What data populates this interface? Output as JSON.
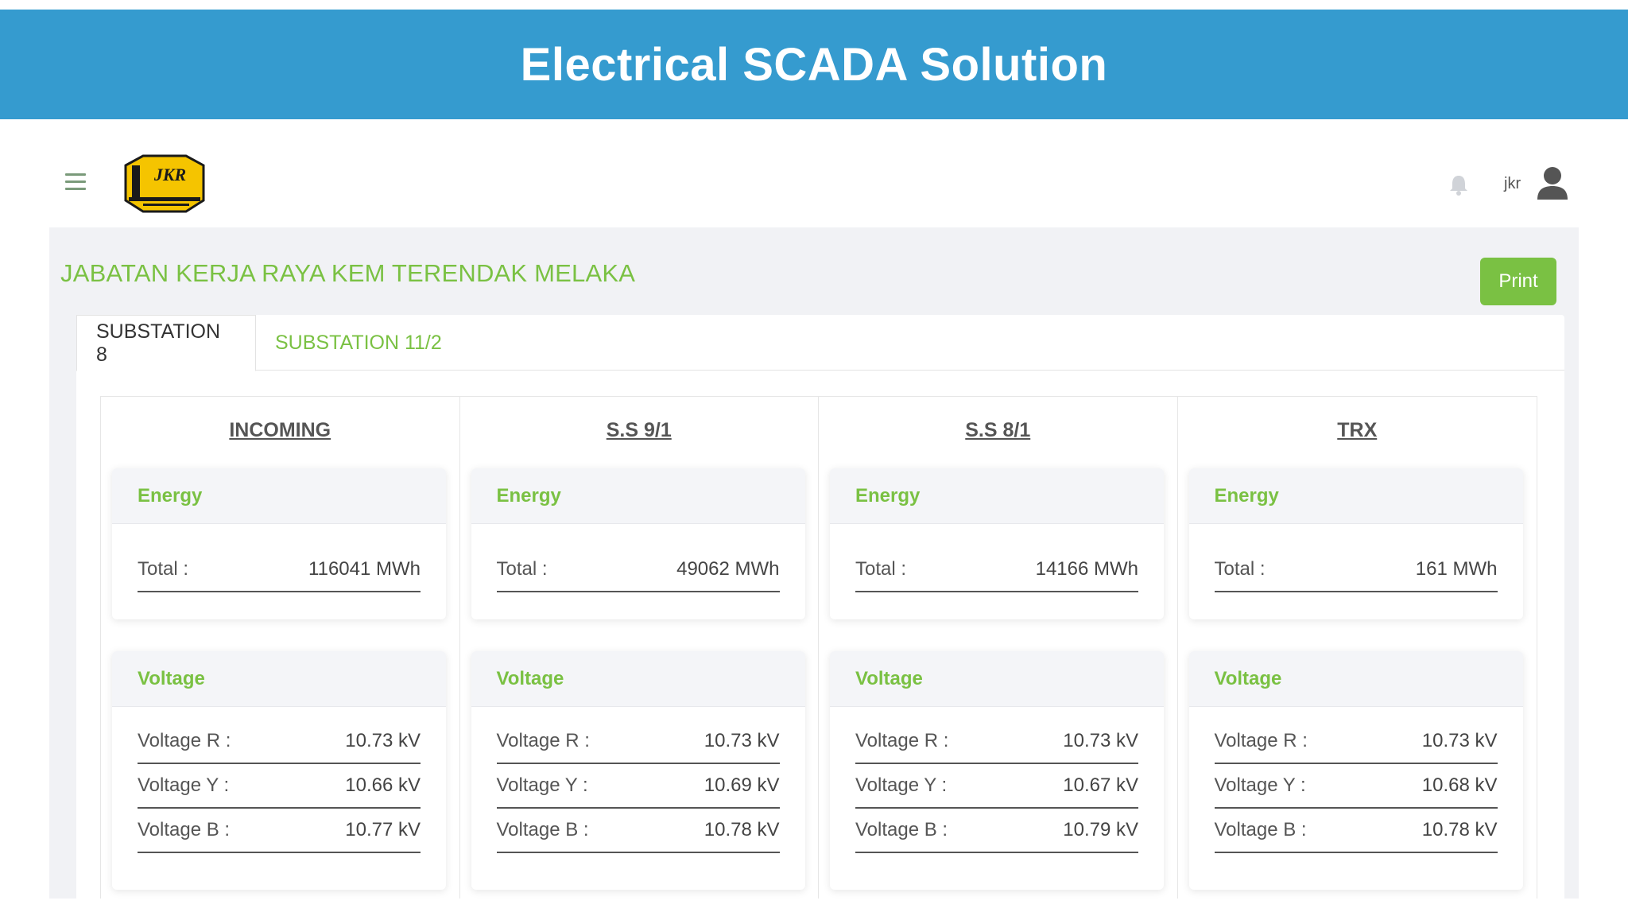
{
  "banner": {
    "title": "Electrical SCADA Solution"
  },
  "header": {
    "logo_text": "JKR",
    "user": "jkr"
  },
  "page": {
    "title": "JABATAN KERJA RAYA KEM TERENDAK MELAKA",
    "print_label": "Print"
  },
  "tabs": [
    {
      "label": "SUBSTATION 8",
      "active": true
    },
    {
      "label": "SUBSTATION 11/2",
      "active": false
    }
  ],
  "colors": {
    "banner": "#359bcf",
    "accent": "#7ac143",
    "content_bg": "#f1f2f5"
  },
  "columns": [
    {
      "title": "INCOMING",
      "energy": {
        "heading": "Energy",
        "total_label": "Total :",
        "total_value": "116041 MWh"
      },
      "voltage": {
        "heading": "Voltage",
        "r_label": "Voltage R :",
        "r_value": "10.73 kV",
        "y_label": "Voltage Y :",
        "y_value": "10.66 kV",
        "b_label": "Voltage B :",
        "b_value": "10.77 kV"
      }
    },
    {
      "title": "S.S 9/1",
      "energy": {
        "heading": "Energy",
        "total_label": "Total :",
        "total_value": "49062 MWh"
      },
      "voltage": {
        "heading": "Voltage",
        "r_label": "Voltage R :",
        "r_value": "10.73 kV",
        "y_label": "Voltage Y :",
        "y_value": "10.69 kV",
        "b_label": "Voltage B :",
        "b_value": "10.78 kV"
      }
    },
    {
      "title": "S.S 8/1",
      "energy": {
        "heading": "Energy",
        "total_label": "Total :",
        "total_value": "14166 MWh"
      },
      "voltage": {
        "heading": "Voltage",
        "r_label": "Voltage R :",
        "r_value": "10.73 kV",
        "y_label": "Voltage Y :",
        "y_value": "10.67 kV",
        "b_label": "Voltage B :",
        "b_value": "10.79 kV"
      }
    },
    {
      "title": "TRX",
      "energy": {
        "heading": "Energy",
        "total_label": "Total :",
        "total_value": "161 MWh"
      },
      "voltage": {
        "heading": "Voltage",
        "r_label": "Voltage R :",
        "r_value": "10.73 kV",
        "y_label": "Voltage Y :",
        "y_value": "10.68 kV",
        "b_label": "Voltage B :",
        "b_value": "10.78 kV"
      }
    }
  ]
}
